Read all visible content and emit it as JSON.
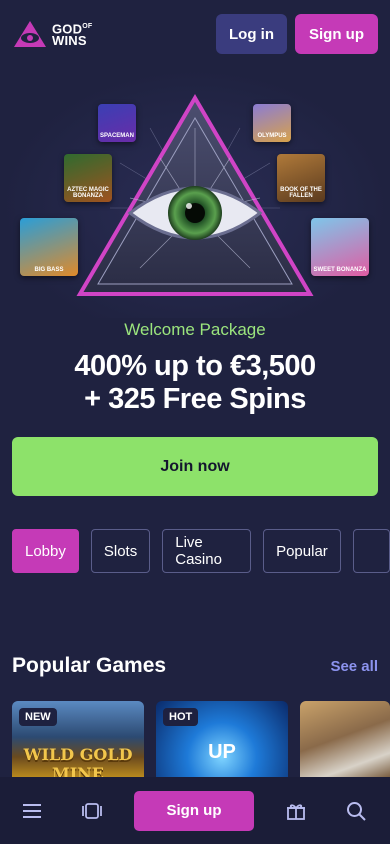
{
  "header": {
    "logo_line1": "GOD",
    "logo_sup": "OF",
    "logo_line2": "WINS",
    "login_label": "Log in",
    "signup_label": "Sign up"
  },
  "hero": {
    "games": [
      {
        "name": "SPACEMAN"
      },
      {
        "name": "OLYMPUS"
      },
      {
        "name": "AZTEC MAGIC BONANZA"
      },
      {
        "name": "BOOK OF THE FALLEN"
      },
      {
        "name": "BIG BASS"
      },
      {
        "name": "SWEET BONANZA"
      }
    ]
  },
  "promo": {
    "subtitle": "Welcome Package",
    "title_line1": "400% up to €3,500",
    "title_line2": "+ 325 Free Spins",
    "join_label": "Join now"
  },
  "tabs": [
    {
      "label": "Lobby",
      "active": true
    },
    {
      "label": "Slots"
    },
    {
      "label": "Live Casino"
    },
    {
      "label": "Popular"
    },
    {
      "label": ""
    }
  ],
  "popular": {
    "title": "Popular Games",
    "see_all": "See all",
    "cards": [
      {
        "badge": "NEW",
        "name": "WILD GOLD MINE"
      },
      {
        "badge": "HOT",
        "name": "UP"
      },
      {
        "badge": "",
        "name": ""
      }
    ]
  },
  "bottom_nav": {
    "signup_label": "Sign up",
    "icons": [
      "menu-icon",
      "cards-icon",
      "gift-icon",
      "search-icon"
    ]
  },
  "colors": {
    "background": "#1f2240",
    "accent_pink": "#c53ab7",
    "accent_green": "#8de26a",
    "login_blue": "#3a3c7e",
    "see_all": "#8c93ee"
  }
}
